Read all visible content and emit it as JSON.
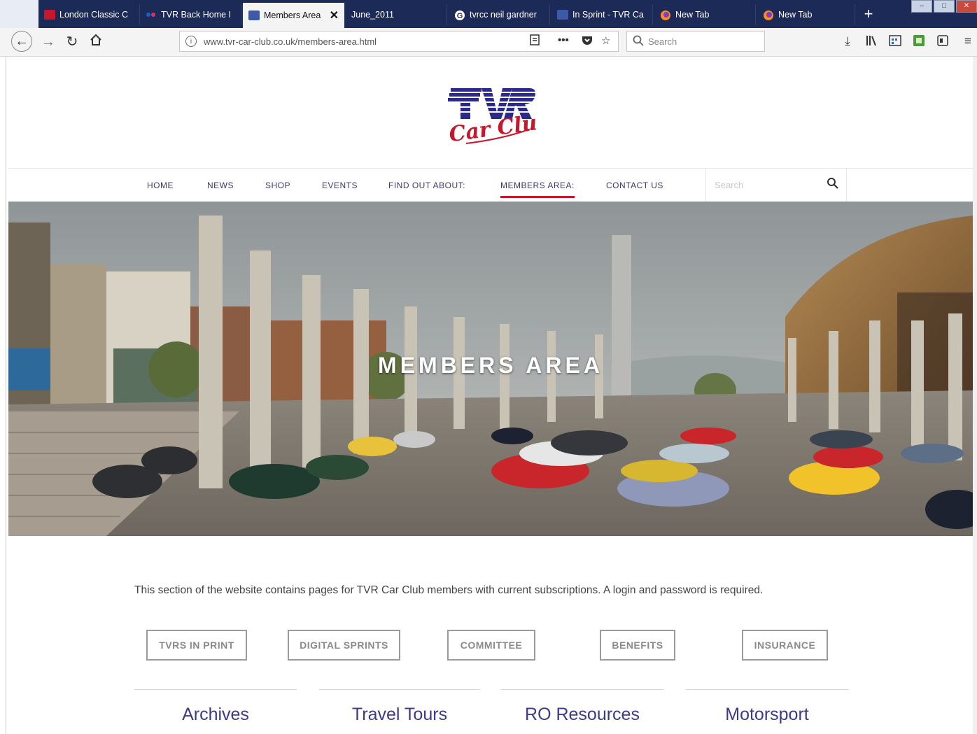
{
  "browser": {
    "tabs": [
      {
        "title": "London Classic C",
        "favicon_color": "#c8172d",
        "active": false
      },
      {
        "title": "TVR Back Home I",
        "favicon_color": "#e0305a",
        "active": false
      },
      {
        "title": "Members Area",
        "favicon_color": "#3d5aa8",
        "active": true
      },
      {
        "title": "June_2011",
        "favicon_color": "",
        "active": false
      },
      {
        "title": "tvrcc neil gardner",
        "favicon_color": "#ffffff",
        "active": false
      },
      {
        "title": "In Sprint - TVR Ca",
        "favicon_color": "#3d5aa8",
        "active": false
      },
      {
        "title": "New Tab",
        "favicon_color": "#ff8a1d",
        "active": false
      },
      {
        "title": "New Tab",
        "favicon_color": "#ff8a1d",
        "active": false
      }
    ],
    "url": "www.tvr-car-club.co.uk/members-area.html",
    "search_placeholder": "Search",
    "icons": {
      "back": "back-arrow-icon",
      "forward": "forward-arrow-icon",
      "reload": "reload-icon",
      "home": "home-icon",
      "reader": "reader-view-icon",
      "more": "more-actions-icon",
      "pocket": "pocket-icon",
      "bookmark": "star-icon",
      "download": "download-icon",
      "library": "library-icon",
      "menu": "hamburger-menu-icon"
    }
  },
  "site": {
    "logo_text": "TVR Car Club",
    "menu": [
      {
        "label": "HOME",
        "active": false
      },
      {
        "label": "NEWS",
        "active": false
      },
      {
        "label": "SHOP",
        "active": false
      },
      {
        "label": "EVENTS",
        "active": false
      },
      {
        "label": "FIND OUT ABOUT:",
        "active": false
      },
      {
        "label": "MEMBERS AREA:",
        "active": true
      },
      {
        "label": "CONTACT US",
        "active": false
      }
    ],
    "menu_search_placeholder": "Search",
    "hero_title": "MEMBERS AREA",
    "intro": "This section of the website contains pages for TVR Car Club members with current subscriptions. A login and password is required.",
    "buttons": [
      "TVRS IN PRINT",
      "DIGITAL SPRINTS",
      "COMMITTEE",
      "BENEFITS",
      "INSURANCE"
    ],
    "sections": [
      "Archives",
      "Travel Tours",
      "RO Resources",
      "Motorsport"
    ],
    "colors": {
      "accent": "#c8172d",
      "brand_blue": "#3d3a8a",
      "menu_text": "#3a3a6a"
    }
  }
}
